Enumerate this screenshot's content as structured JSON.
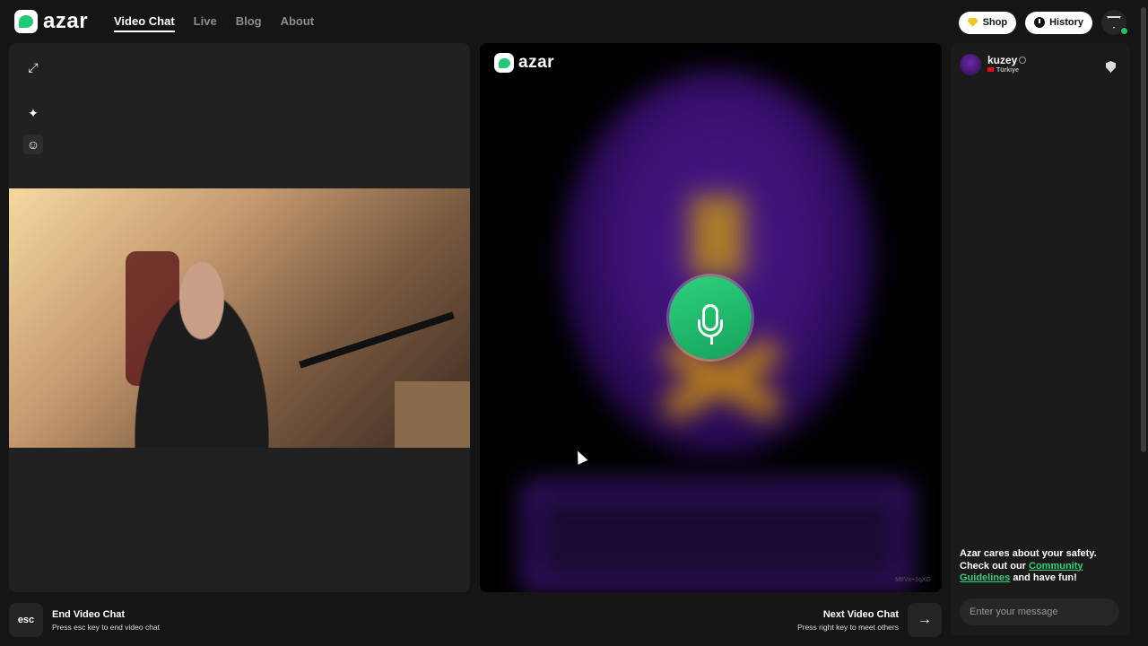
{
  "brand": {
    "name": "azar",
    "accent": "#20c877"
  },
  "nav": {
    "items": [
      {
        "label": "Video Chat",
        "active": true
      },
      {
        "label": "Live",
        "active": false
      },
      {
        "label": "Blog",
        "active": false
      },
      {
        "label": "About",
        "active": false
      }
    ]
  },
  "header": {
    "shop_label": "Shop",
    "history_label": "History"
  },
  "left_tools": {
    "icons": [
      "expand-icon",
      "sparkle-effects-icon",
      "sticker-icon"
    ]
  },
  "remote": {
    "watermark": "azar",
    "session_id": "MtIVx+1qXG",
    "center_icon": "microphone-icon"
  },
  "chat": {
    "peer_name": "kuzey",
    "peer_country": "Türkiye",
    "safety_line1": "Azar cares about your safety.",
    "safety_line2": "Check out our",
    "safety_link": "Community Guidelines",
    "safety_line3": "and have fun!",
    "input_placeholder": "Enter your message"
  },
  "footer": {
    "esc_key": "esc",
    "end_title": "End Video Chat",
    "end_sub": "Press esc key to end video chat",
    "next_title": "Next Video Chat",
    "next_sub": "Press right key to meet others",
    "next_key": "→"
  }
}
